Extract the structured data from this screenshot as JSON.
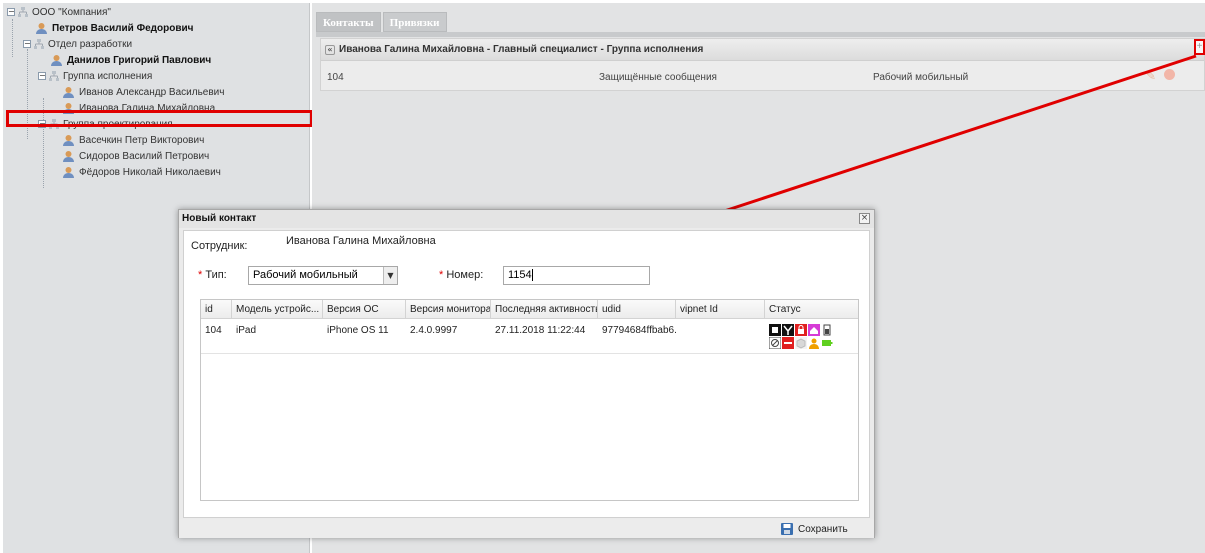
{
  "tree": {
    "items": [
      {
        "label": "ООО \"Компания\"",
        "type": "org",
        "bold": false
      },
      {
        "label": "Петров Василий Федорович",
        "type": "person",
        "bold": true
      },
      {
        "label": "Отдел разработки",
        "type": "org",
        "bold": false
      },
      {
        "label": "Данилов Григорий Павлович",
        "type": "person",
        "bold": true
      },
      {
        "label": "Группа исполнения",
        "type": "org",
        "bold": false
      },
      {
        "label": "Иванов Александр Васильевич",
        "type": "person",
        "bold": false
      },
      {
        "label": "Иванова Галина Михайловна",
        "type": "person",
        "bold": false
      },
      {
        "label": "Группа проектирования",
        "type": "org",
        "bold": false
      },
      {
        "label": "Васечкин Петр Викторович",
        "type": "person",
        "bold": false
      },
      {
        "label": "Сидоров Василий Петрович",
        "type": "person",
        "bold": false
      },
      {
        "label": "Фёдоров Николай Николаевич",
        "type": "person",
        "bold": false
      }
    ],
    "selected_index": 6
  },
  "tabs": [
    {
      "label": "Контакты"
    },
    {
      "label": "Привязки"
    }
  ],
  "contacts": {
    "group_title": "Иванова Галина Михайловна - Главный специалист - Группа исполнения",
    "row": {
      "number": "104",
      "messaging": "Защищённые сообщения",
      "type": "Рабочий мобильный"
    }
  },
  "dialog": {
    "title": "Новый контакт",
    "employee_label": "Сотрудник:",
    "employee_value": "Иванова Галина Михайловна",
    "type_label": "Тип:",
    "type_value": "Рабочий мобильный",
    "number_label": "Номер:",
    "number_value": "1154",
    "grid": {
      "columns": [
        "id",
        "Модель устройс...",
        "Версия ОС",
        "Версия монитора",
        "Последняя активность",
        "udid",
        "vipnet Id",
        "Статус"
      ],
      "rows": [
        {
          "id": "104",
          "model": "iPad",
          "os": "iPhone OS 11",
          "monitor": "2.4.0.9997",
          "last_activity": "27.11.2018 11:22:44",
          "udid": "97794684ffbab6...",
          "vipnet": ""
        }
      ]
    },
    "save_label": "Сохранить"
  },
  "colors": {
    "annotation": "#e00000",
    "tree_bg": "#dfe1e3",
    "panel_bg": "#e2e3e4",
    "person_icon": "#d99a57",
    "status_magenta": "#d63bd6",
    "status_red": "#e02020",
    "status_orange": "#f0a000",
    "status_green": "#60d020"
  },
  "icons": [
    "org-icon",
    "person-icon",
    "collapse-icon",
    "add-icon",
    "edit-icon",
    "delete-icon",
    "close-icon",
    "disk-icon",
    "status-icons"
  ]
}
